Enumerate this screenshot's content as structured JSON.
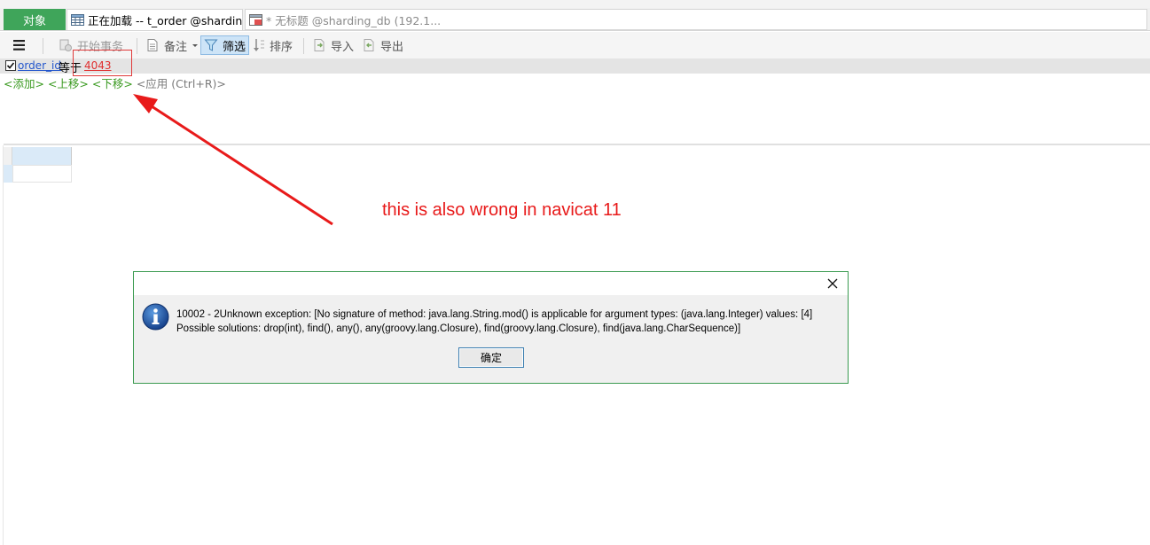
{
  "tabs": {
    "objects_label": "对象",
    "active_label": "正在加载 -- t_order @shardin...",
    "inactive_label": "* 无标题 @sharding_db (192.1..."
  },
  "toolbar": {
    "menu_icon": "hamburger-icon",
    "begin_transaction": "开始事务",
    "note": "备注",
    "filter": "筛选",
    "sort": "排序",
    "import": "导入",
    "export": "导出"
  },
  "filter": {
    "checked": true,
    "field": "order_id",
    "operator": "等于",
    "value": "4043"
  },
  "filter_commands": {
    "add": "<添加>",
    "move_up": "<上移>",
    "move_down": "<下移>",
    "apply": "<应用 (Ctrl+R)>"
  },
  "annotation": {
    "text": "this is also wrong in navicat 11",
    "color": "#e81a1a"
  },
  "dialog": {
    "message_line1": "10002 - 2Unknown exception: [No signature of method: java.lang.String.mod() is applicable for argument types: (java.lang.Integer) values: [4]",
    "message_line2": "Possible solutions: drop(int), find(), any(), any(groovy.lang.Closure), find(groovy.lang.Closure), find(java.lang.CharSequence)]",
    "ok_label": "确定",
    "icon": "info-icon"
  },
  "colors": {
    "accent_green": "#3fa55a",
    "info_blue": "#1f5fb0"
  }
}
